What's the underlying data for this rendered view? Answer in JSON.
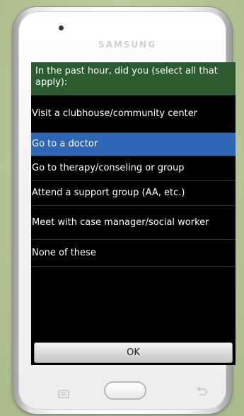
{
  "device": {
    "brand": "SAMSUNG"
  },
  "dialog": {
    "question": "In the past hour, did you (select all that apply):",
    "options": [
      {
        "label": "Visit a clubhouse/community center",
        "selected": false
      },
      {
        "label": "Go to a doctor",
        "selected": true
      },
      {
        "label": "Go to therapy/conseling or group",
        "selected": false
      },
      {
        "label": "Attend a support group (AA, etc.)",
        "selected": false
      },
      {
        "label": "Meet with case manager/social worker",
        "selected": false
      },
      {
        "label": "None of these",
        "selected": false
      }
    ],
    "ok_label": "OK"
  },
  "colors": {
    "header_bg": "#2d5a2f",
    "selected_bg": "#2f66b8",
    "screen_bg": "#000000"
  },
  "icons": {
    "menu": "menu-icon",
    "home": "home-button",
    "back": "back-icon"
  }
}
